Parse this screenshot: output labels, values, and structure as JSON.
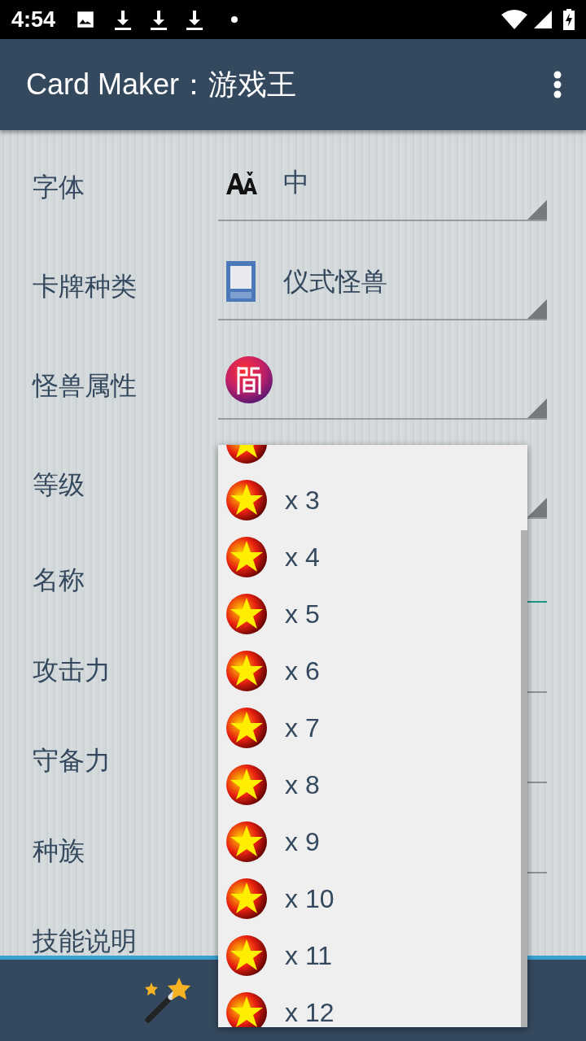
{
  "status_bar": {
    "time": "4:54"
  },
  "app_bar": {
    "title": "Card Maker：游戏王"
  },
  "form": [
    {
      "kind": "spinner",
      "label": "字体",
      "value": "中"
    },
    {
      "kind": "spinner",
      "label": "卡牌种类",
      "value": "仪式怪兽"
    },
    {
      "kind": "spinner",
      "label": "怪兽属性"
    },
    {
      "kind": "spinner",
      "label": "等级"
    },
    {
      "kind": "text",
      "label": "名称",
      "focused": true
    },
    {
      "kind": "text",
      "label": "攻击力",
      "focused": false
    },
    {
      "kind": "text",
      "label": "守备力",
      "focused": false
    },
    {
      "kind": "text",
      "label": "种族",
      "focused": false
    },
    {
      "kind": "label",
      "label": "技能说明"
    }
  ],
  "level_dropdown": {
    "options": [
      "x 3",
      "x 4",
      "x 5",
      "x 6",
      "x 7",
      "x 8",
      "x 9",
      "x 10",
      "x 11",
      "x 12"
    ]
  }
}
